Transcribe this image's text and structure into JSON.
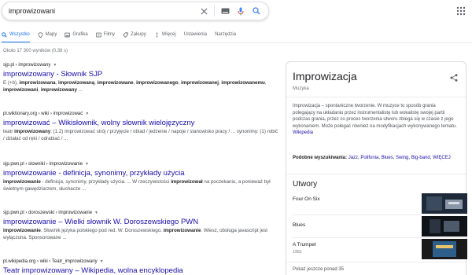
{
  "search": {
    "query": "improwizowani"
  },
  "tabs": [
    {
      "label": "Wszystko",
      "icon": "search-icon",
      "active": true
    },
    {
      "label": "Mapy",
      "icon": "map-pin-icon"
    },
    {
      "label": "Grafika",
      "icon": "image-icon"
    },
    {
      "label": "Filmy",
      "icon": "video-icon"
    },
    {
      "label": "Zakupy",
      "icon": "tag-icon"
    },
    {
      "label": "Więcej",
      "icon": "more-vert-icon"
    },
    {
      "label": "Ustawienia"
    },
    {
      "label": "Narzędzia"
    }
  ],
  "result_stats": "Około 17 300 wyników (0,38 s)",
  "results": [
    {
      "breadcrumb": "sjp.pl › improwizowany",
      "title": "improwizowany - Słownik SJP",
      "snippet_html": "E (+b), <b>improwizowana</b>, <b>improwizowaną</b>, <b>improwizowane</b>, <b>improwizowanego</b>, <b>improwizowanej</b>, <b>improwizowanemu</b>, <b>improwizowani</b>, <b>improwizowany</b> ..."
    },
    {
      "breadcrumb": "pl.wiktionary.org › wiki › improwizować",
      "title": "improwizować – Wikisłownik, wolny słownik wielojęzyczny",
      "snippet_html": "teatr <b>improwizowany</b>: (1.2) improwizować strój / przyjęcie / obiad / jedzenie / napoje / stanowisko pracy / ... synonimy: (1) robić / działać od ręki / odrabiać / ..."
    },
    {
      "breadcrumb": "sjp.pwn.pl › slowniki › improwizowanie",
      "title": "improwizowanie - definicja, synonimy, przykłady użycia",
      "snippet_html": "<b>improwizowanie</b> - definicja, synonimy, przykłady użycia. ... W rzeczywistości <b>improwizował</b> na poczekaniu, a ponieważ był świetnym gawędziarzem, słuchacze ..."
    },
    {
      "breadcrumb": "sjp.pwn.pl › doroszewski › improwizowanie",
      "title": "improwizowanie – Wielki słownik W. Doroszewskiego PWN",
      "snippet_html": "<b>improwizowanie</b>. Słownik języka polskiego pod red. W. Doroszewskiego. <b>improwizowanie</b>. Wiesz, obsługa javascript jest wyłączona. Sponsorowane ..."
    },
    {
      "breadcrumb": "pl.wikipedia.org › wiki › Teatr_improwizowany",
      "title": "Teatr improwizowany – Wikipedia, wolna encyklopedia",
      "snippet_html": ""
    }
  ],
  "knowledge_panel": {
    "title": "Improwizacja",
    "subtitle": "Muzyka",
    "description_html": "Improwizacja – spontaniczne tworzenie. W muzyce to sposób grania polegający na układaniu przez instrumentalistę lub wokalistę swojej partii podczas grania, przez co proces tworzenia utworu zbiega się w czasie z jego wykonaniem. Może polegać również na modyfikacjach wykonywanego tematu. <a>Wikipedia</a>",
    "related_label": "Podobne wyszukiwania:",
    "related_items": "Jazz, Polifonia, Blues, Swing, Big-band, WIĘCEJ",
    "section_title": "Utwory",
    "songs": [
      {
        "title": "Four On Six",
        "year": ""
      },
      {
        "title": "Blues",
        "year": ""
      },
      {
        "title": "A Trumpet",
        "year": "1951"
      }
    ],
    "more_label": "Pokaż jeszcze ponad 35"
  },
  "colors": {
    "link": "#1a0dab",
    "accent": "#1a73e8",
    "text": "#202124",
    "muted": "#70757a"
  }
}
